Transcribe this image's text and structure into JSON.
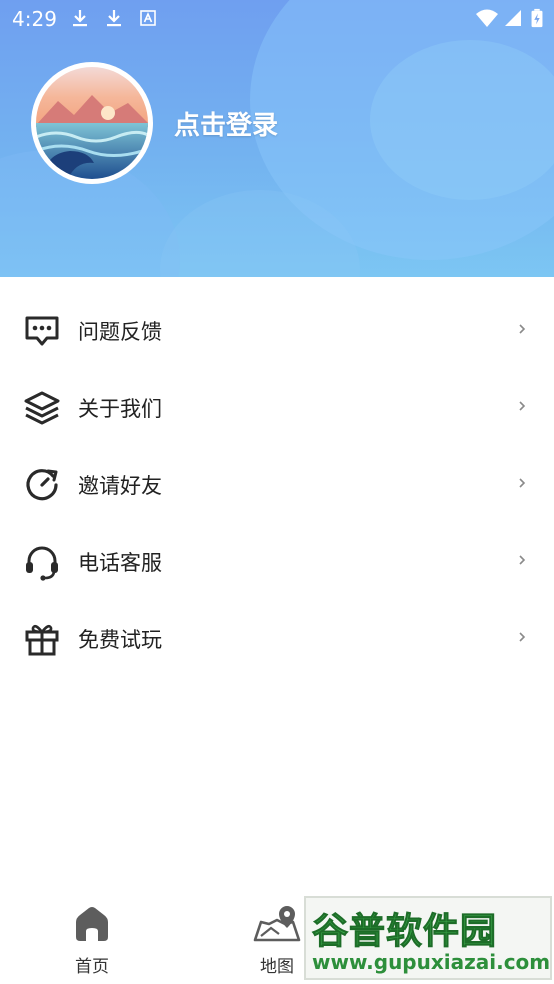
{
  "status_bar": {
    "time": "4:29",
    "left_icons": [
      "download-icon",
      "download-icon",
      "text-icon"
    ],
    "right_icons": [
      "wifi-icon",
      "signal-icon",
      "battery-charging-icon"
    ]
  },
  "header": {
    "login_text": "点击登录",
    "avatar": "avatar-sunset-sea"
  },
  "menu": {
    "items": [
      {
        "label": "问题反馈",
        "icon": "chat-bubble-icon"
      },
      {
        "label": "关于我们",
        "icon": "layers-icon"
      },
      {
        "label": "邀请好友",
        "icon": "refresh-arrow-icon"
      },
      {
        "label": "电话客服",
        "icon": "headset-icon"
      },
      {
        "label": "免费试玩",
        "icon": "gift-icon"
      }
    ]
  },
  "tabbar": {
    "tabs": [
      {
        "label": "首页",
        "icon": "home-icon"
      },
      {
        "label": "地图",
        "icon": "map-pin-icon"
      }
    ]
  },
  "watermark": {
    "title": "谷普软件园",
    "url": "www.gupuxiazai.com"
  },
  "colors": {
    "header_top": "#6f9ff0",
    "header_bottom": "#7cc6f3",
    "icon_dark": "#2a2a2a"
  }
}
